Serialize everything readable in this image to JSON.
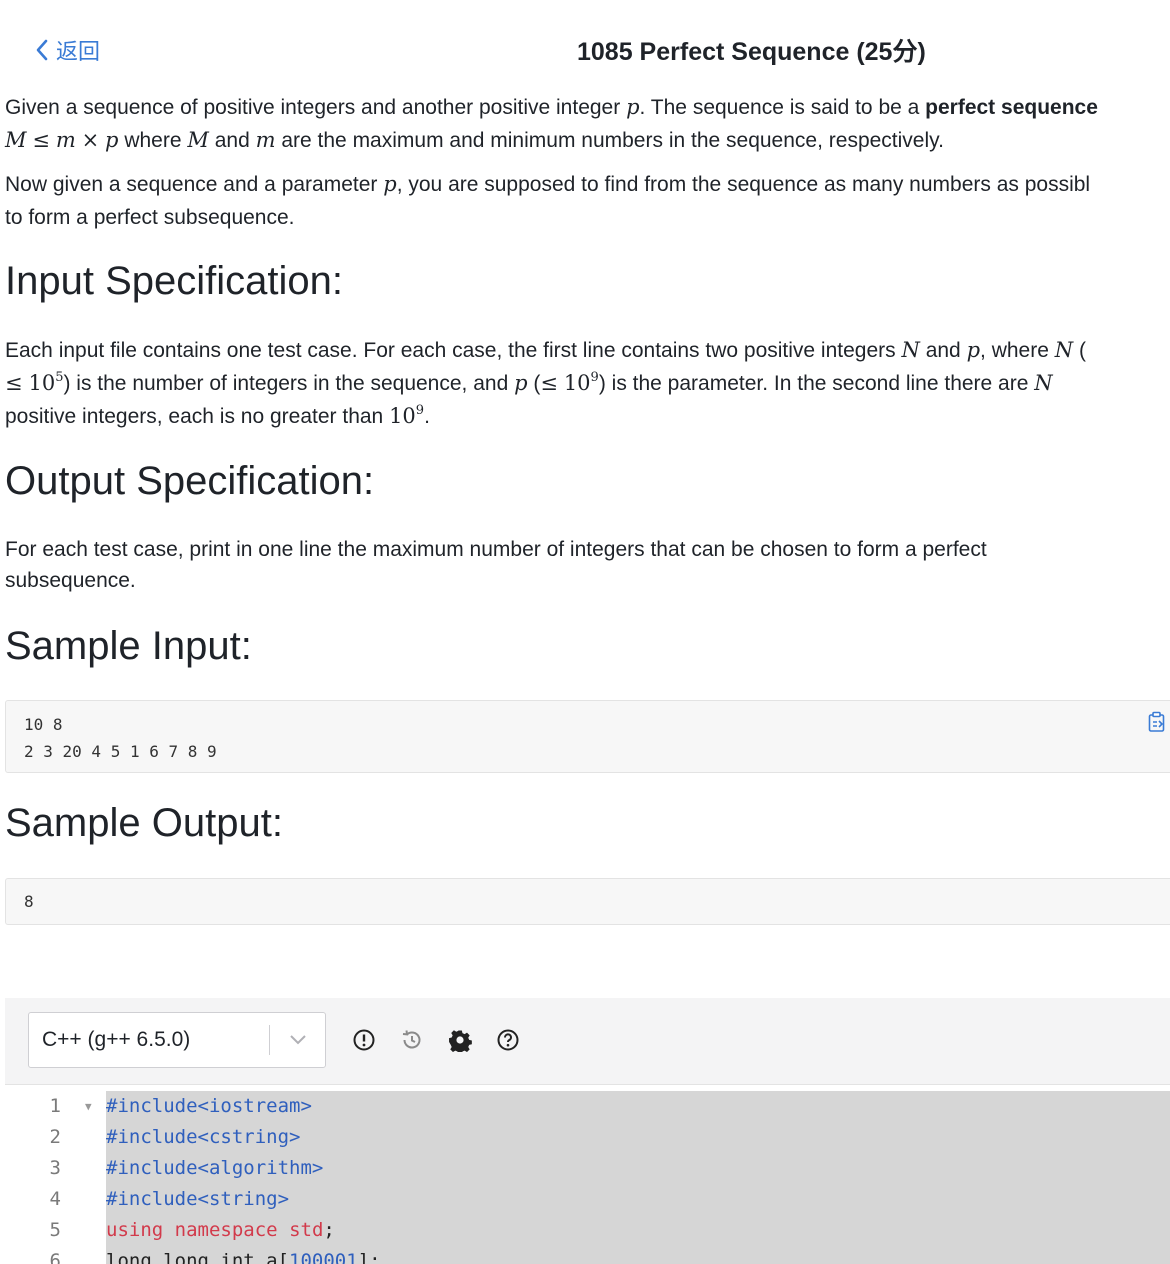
{
  "nav": {
    "back_label": "返回"
  },
  "problem": {
    "title": "1085 Perfect Sequence (25分)",
    "intro": {
      "t1": "Given a sequence of positive integers and another positive integer ",
      "t2": ". The sequence is said to be a ",
      "t3": "perfect sequence",
      "t4": " where ",
      "t5": " and ",
      "t6": " are the maximum and minimum numbers in the sequence, respectively.",
      "t7": "Now given a sequence and a parameter ",
      "t8": ", you are supposed to find from the sequence as many numbers as possibl",
      "t9": "to form a perfect subsequence."
    },
    "math": {
      "p": "p",
      "M": "M",
      "m": "m",
      "le": "≤",
      "times": "×",
      "N": "N",
      "ten": "10",
      "five": "5",
      "nine": "9"
    },
    "input_heading": "Input Specification:",
    "input_spec": {
      "a1": "Each input file contains one test case. For each case, the first line contains two positive integers ",
      "a2": " and ",
      "a3": ", where ",
      "a4": " (",
      "b1": ") is the number of integers in the sequence, and ",
      "b2": " (",
      "b3": ") is the parameter. In the second line there are ",
      "c1": "positive integers, each is no greater than ",
      "c2": "."
    },
    "output_heading": "Output Specification:",
    "output_spec": {
      "l1": "For each test case, print in one line the maximum number of integers that can be chosen to form a perfect",
      "l2": "subsequence."
    },
    "sample_input_heading": "Sample Input:",
    "sample_input_lines": [
      "10 8",
      "2 3 20 4 5 1 6 7 8 9"
    ],
    "sample_output_heading": "Sample Output:",
    "sample_output_lines": [
      "8"
    ]
  },
  "editor_toolbar": {
    "language": "C++ (g++ 6.5.0)",
    "icons": [
      "alert-circle-icon",
      "history-icon",
      "gear-icon",
      "help-circle-icon"
    ]
  },
  "editor": {
    "lines": [
      {
        "n": "1",
        "code": "#include<iostream>"
      },
      {
        "n": "2",
        "code": "#include<cstring>"
      },
      {
        "n": "3",
        "code": "#include<algorithm>"
      },
      {
        "n": "4",
        "code": "#include<string>"
      },
      {
        "n": "5",
        "c1": "using",
        "c2": "namespace",
        "c3": "std",
        "c4": ";"
      },
      {
        "n": "6",
        "c1": "long long int a[",
        "c2": "100001",
        "c3": "];"
      }
    ]
  },
  "colors": {
    "link": "#3a7bd5",
    "keyword_blue": "#2f5fbd",
    "keyword_red": "#d23a4b",
    "selection": "#d6d6d6"
  }
}
